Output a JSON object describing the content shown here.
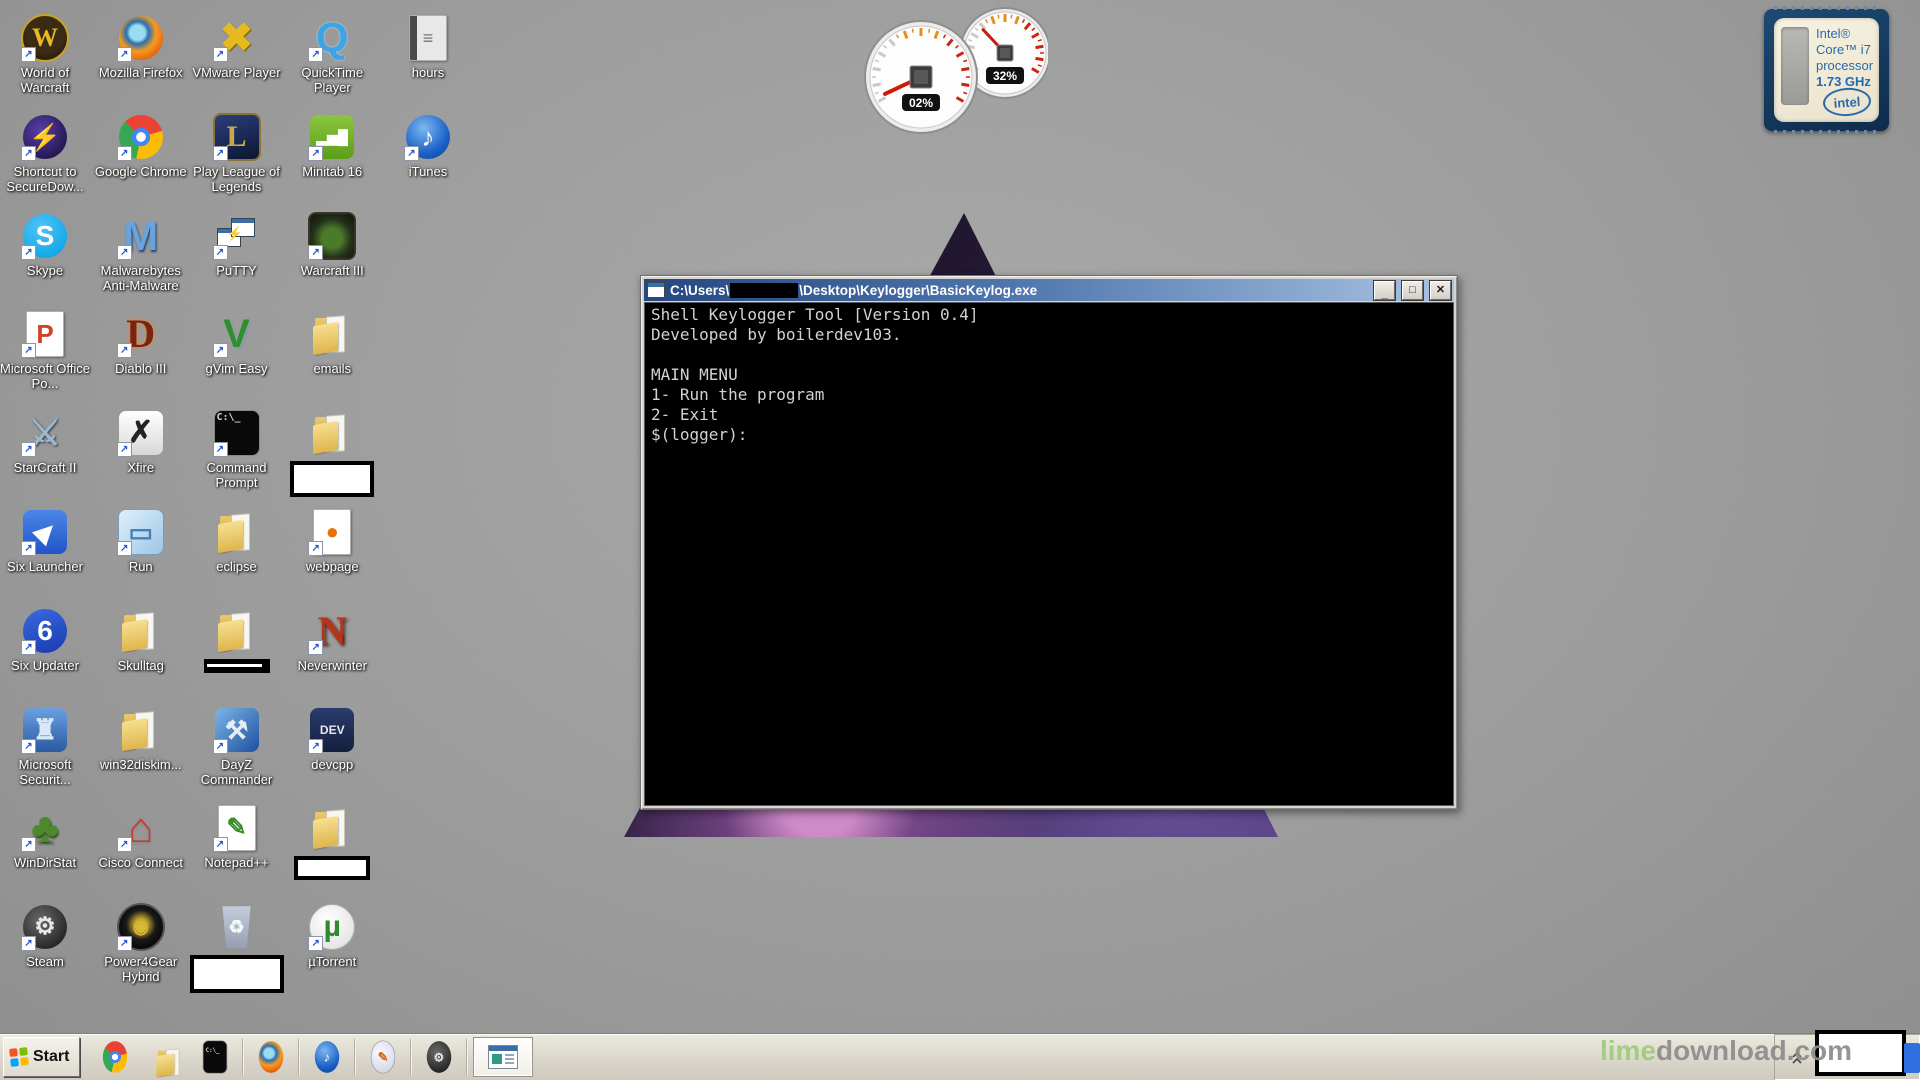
{
  "desktop": {
    "background_color": "#9b9b9b",
    "wallpaper_logo": "purple-galaxy-triangle",
    "icons": [
      {
        "id": "world-of-warcraft",
        "label": "World of Warcraft",
        "col": 1,
        "row": 1,
        "shortcut": true,
        "art": {
          "shape": "circle",
          "bg": "radial-gradient(circle at 50% 40%, #3a2c14 0 55%, #120d04 100%)",
          "border": "2px solid #c9a227",
          "glyph": "W",
          "gcolor": "#e8b923",
          "gsize": 26,
          "serif": true
        }
      },
      {
        "id": "mozilla-firefox",
        "label": "Mozilla Firefox",
        "col": 2,
        "row": 1,
        "shortcut": true,
        "art": {
          "shape": "circle",
          "bg": "radial-gradient(circle at 42% 38%, #9adcf0 0 20%, #2a6fb0 30%, #f79b1e 50%, #e4650e 75%, #b23d05 100%)"
        }
      },
      {
        "id": "vmware-player",
        "label": "VMware Player",
        "col": 3,
        "row": 1,
        "shortcut": true,
        "art": {
          "shape": "none",
          "glyph": "✖",
          "gcolor": "#e6b91e",
          "gsize": 40,
          "gshadow": "1px 1px 1px #7a5c00"
        }
      },
      {
        "id": "quicktime-player",
        "label": "QuickTime Player",
        "col": 4,
        "row": 1,
        "shortcut": true,
        "art": {
          "shape": "none",
          "glyph": "Q",
          "gcolor": "#3fa3e8",
          "gsize": 42,
          "gshadow": "0 0 2px #b8e0f8"
        }
      },
      {
        "id": "hours",
        "label": "hours",
        "col": 5,
        "row": 1,
        "shortcut": false,
        "art": {
          "shape": "doc",
          "bg": "linear-gradient(90deg,#4a4a4a 0 20%, #e8e8e8 20% 100%)",
          "glyph": "≡",
          "gcolor": "#777",
          "gsize": 18
        }
      },
      {
        "id": "shortcut-to-securedow",
        "label": "Shortcut to SecureDow...",
        "col": 1,
        "row": 2,
        "shortcut": true,
        "art": {
          "shape": "circle",
          "bg": "radial-gradient(circle at 40% 35%, #5a3fa8, #261a58 70%)",
          "glyph": "⚡",
          "gcolor": "#f5c518",
          "gsize": 26
        }
      },
      {
        "id": "google-chrome",
        "label": "Google Chrome",
        "col": 2,
        "row": 2,
        "shortcut": true,
        "art": {
          "shape": "circle",
          "bg": "radial-gradient(circle at 50% 50%, #ffffff 0 15%, #4285f4 16% 29%, rgba(0,0,0,0) 30%), conic-gradient(from -45deg, #ea4335 0 33%, #fbbc05 0 66%, #34a853 0 100%)"
        }
      },
      {
        "id": "play-league-of-legends",
        "label": "Play League of Legends",
        "col": 3,
        "row": 2,
        "shortcut": true,
        "art": {
          "shape": "rsq",
          "bg": "linear-gradient(160deg,#2a3f7e,#0c1630)",
          "border": "2px solid #8a7438",
          "glyph": "L",
          "gcolor": "#c8a84a",
          "gsize": 30,
          "serif": true
        }
      },
      {
        "id": "minitab-16",
        "label": "Minitab 16",
        "col": 4,
        "row": 2,
        "shortcut": true,
        "art": {
          "shape": "rsq",
          "bg": "linear-gradient(180deg,#8cc63f,#5a9e1a)",
          "glyph": "▂▅█",
          "gcolor": "#ffffff",
          "gsize": 14
        }
      },
      {
        "id": "itunes",
        "label": "iTunes",
        "col": 5,
        "row": 2,
        "shortcut": true,
        "art": {
          "shape": "circle",
          "bg": "radial-gradient(circle at 40% 30%, #7db8f0, #1c63c8 60%, #0b3f96)",
          "glyph": "♪",
          "gcolor": "#ffffff",
          "gsize": 26
        }
      },
      {
        "id": "skype",
        "label": "Skype",
        "col": 1,
        "row": 3,
        "shortcut": true,
        "art": {
          "shape": "circle",
          "bg": "radial-gradient(circle at 40% 30%, #4fc3f7, #009fe3)",
          "glyph": "S",
          "gcolor": "#ffffff",
          "gsize": 28
        }
      },
      {
        "id": "malwarebytes-anti-malware",
        "label": "Malwarebytes Anti-Malware",
        "col": 2,
        "row": 3,
        "shortcut": true,
        "art": {
          "shape": "none",
          "glyph": "M",
          "gcolor": "#6aa2dc",
          "gsize": 42,
          "gshadow": "1px 2px 2px #1c3c64"
        }
      },
      {
        "id": "putty",
        "label": "PuTTY",
        "col": 3,
        "row": 3,
        "shortcut": true,
        "art": {
          "shape": "putty"
        }
      },
      {
        "id": "warcraft-iii",
        "label": "Warcraft III",
        "col": 4,
        "row": 3,
        "shortcut": true,
        "art": {
          "shape": "rsq",
          "bg": "radial-gradient(circle at 50% 55%, #4a7a2a 0 30%, #22301a 60%, #121208 100%)",
          "border": "2px solid #3a3424"
        }
      },
      {
        "id": "microsoft-office-po",
        "label": "Microsoft Office Po...",
        "col": 1,
        "row": 4,
        "shortcut": true,
        "art": {
          "shape": "doc",
          "bg": "#ffffff",
          "glyph": "P",
          "gcolor": "#d04423",
          "gsize": 26
        }
      },
      {
        "id": "diablo-iii",
        "label": "Diablo III",
        "col": 2,
        "row": 4,
        "shortcut": true,
        "art": {
          "shape": "none",
          "glyph": "D",
          "gcolor": "#7a2410",
          "gsize": 40,
          "serif": true,
          "gshadow": "0 0 4px #f08030"
        }
      },
      {
        "id": "gvim-easy",
        "label": "gVim Easy",
        "col": 3,
        "row": 4,
        "shortcut": true,
        "art": {
          "shape": "none",
          "glyph": "V",
          "gcolor": "#2f8f2f",
          "gsize": 40,
          "gshadow": "2px 2px 2px #8a9aa8"
        }
      },
      {
        "id": "emails",
        "label": "emails",
        "col": 4,
        "row": 4,
        "shortcut": false,
        "art": {
          "shape": "folder"
        }
      },
      {
        "id": "starcraft-ii",
        "label": "StarCraft II",
        "col": 1,
        "row": 5,
        "shortcut": true,
        "art": {
          "shape": "none",
          "glyph": "⚔",
          "gcolor": "#9fb6c8",
          "gsize": 36,
          "gshadow": "1px 1px 2px #2a3a4a"
        }
      },
      {
        "id": "xfire",
        "label": "Xfire",
        "col": 2,
        "row": 5,
        "shortcut": true,
        "art": {
          "shape": "rsq",
          "bg": "linear-gradient(180deg,#ffffff,#d8d8d8)",
          "border": "1px solid #999",
          "glyph": "✗",
          "gcolor": "#222",
          "gsize": 30
        }
      },
      {
        "id": "command-prompt",
        "label": "Command Prompt",
        "col": 3,
        "row": 5,
        "shortcut": true,
        "art": {
          "shape": "rsq",
          "bg": "#0a0a0a",
          "border": "1px solid #888",
          "glyph": "C:\\_",
          "gcolor": "#d8d8d8",
          "gsize": 10,
          "tl": true
        }
      },
      {
        "id": "censored-folder-1",
        "label": "",
        "col": 4,
        "row": 5,
        "shortcut": false,
        "censor": "white-box",
        "cw": 76,
        "ch": 28,
        "art": {
          "shape": "folder"
        }
      },
      {
        "id": "six-launcher",
        "label": "Six Launcher",
        "col": 1,
        "row": 6,
        "shortcut": true,
        "art": {
          "shape": "rsq",
          "bg": "linear-gradient(180deg,#4a86e8,#2255c8)",
          "glyph": "▶",
          "gcolor": "#ffffff",
          "gsize": 24,
          "rot": true
        }
      },
      {
        "id": "run",
        "label": "Run",
        "col": 2,
        "row": 6,
        "shortcut": true,
        "art": {
          "shape": "rsq",
          "bg": "linear-gradient(135deg,#dff0fa,#9cc6e8)",
          "border": "1px solid #7a9ab8",
          "glyph": "▭",
          "gcolor": "#4a80b8",
          "gsize": 26
        }
      },
      {
        "id": "eclipse",
        "label": "eclipse",
        "col": 3,
        "row": 6,
        "shortcut": false,
        "art": {
          "shape": "folder"
        }
      },
      {
        "id": "webpage",
        "label": "webpage",
        "col": 4,
        "row": 6,
        "shortcut": true,
        "art": {
          "shape": "doc",
          "bg": "#ffffff",
          "glyph": "●",
          "gcolor": "#e8710a",
          "gsize": 22
        }
      },
      {
        "id": "six-updater",
        "label": "Six Updater",
        "col": 1,
        "row": 7,
        "shortcut": true,
        "art": {
          "shape": "circle",
          "bg": "linear-gradient(160deg,#3a6ae0,#1a3ab0)",
          "glyph": "6",
          "gcolor": "#ffffff",
          "gsize": 28
        }
      },
      {
        "id": "skulltag",
        "label": "Skulltag",
        "col": 2,
        "row": 7,
        "shortcut": false,
        "art": {
          "shape": "folder"
        }
      },
      {
        "id": "censored-folder-2",
        "label": "",
        "col": 3,
        "row": 7,
        "shortcut": false,
        "censor": "black-bar",
        "cw": 66,
        "ch": 14,
        "art": {
          "shape": "folder"
        }
      },
      {
        "id": "neverwinter",
        "label": "Neverwinter",
        "col": 4,
        "row": 7,
        "shortcut": true,
        "art": {
          "shape": "none",
          "glyph": "N",
          "gcolor": "#b83418",
          "gsize": 40,
          "serif": true,
          "gshadow": "2px 2px 3px #3a0e04"
        }
      },
      {
        "id": "microsoft-securit",
        "label": "Microsoft Securit...",
        "col": 1,
        "row": 8,
        "shortcut": true,
        "art": {
          "shape": "rsq",
          "bg": "linear-gradient(180deg,#6aa0e0,#2a5aa0)",
          "glyph": "♜",
          "gcolor": "#d8e8f8",
          "gsize": 28
        }
      },
      {
        "id": "win32diskim",
        "label": "win32diskim...",
        "col": 2,
        "row": 8,
        "shortcut": false,
        "art": {
          "shape": "folder"
        }
      },
      {
        "id": "dayz-commander",
        "label": "DayZ Commander",
        "col": 3,
        "row": 8,
        "shortcut": true,
        "art": {
          "shape": "rsq",
          "bg": "linear-gradient(135deg,#7ab6e8,#1e4f9e)",
          "glyph": "⚒",
          "gcolor": "#e8edf4",
          "gsize": 26
        }
      },
      {
        "id": "devcpp",
        "label": "devcpp",
        "col": 4,
        "row": 8,
        "shortcut": true,
        "art": {
          "shape": "rsq",
          "bg": "linear-gradient(180deg,#2a3c6e,#14203e)",
          "glyph": "DEV",
          "gcolor": "#e8e8f0",
          "gsize": 12
        }
      },
      {
        "id": "windirstat",
        "label": "WinDirStat",
        "col": 1,
        "row": 9,
        "shortcut": true,
        "art": {
          "shape": "none",
          "glyph": "♣",
          "gcolor": "#4a8a2a",
          "gsize": 42,
          "gshadow": "1px 2px 2px #2a4a1a"
        }
      },
      {
        "id": "cisco-connect",
        "label": "Cisco Connect",
        "col": 2,
        "row": 9,
        "shortcut": true,
        "art": {
          "shape": "none",
          "glyph": "⌂",
          "gcolor": "#c23a2e",
          "gsize": 42,
          "gshadow": "0 2px 2px #888"
        }
      },
      {
        "id": "notepadpp",
        "label": "Notepad++",
        "col": 3,
        "row": 9,
        "shortcut": true,
        "art": {
          "shape": "doc",
          "bg": "#ffffff",
          "glyph": "✎",
          "gcolor": "#3a8a2a",
          "gsize": 24
        }
      },
      {
        "id": "censored-folder-3",
        "label": "",
        "col": 4,
        "row": 9,
        "shortcut": false,
        "censor": "white-box",
        "cw": 68,
        "ch": 16,
        "art": {
          "shape": "folder"
        }
      },
      {
        "id": "steam",
        "label": "Steam",
        "col": 1,
        "row": 10,
        "shortcut": true,
        "art": {
          "shape": "circle",
          "bg": "radial-gradient(circle at 40% 35%, #6a6a6a, #2a2a2a 70%, #111 100%)",
          "glyph": "⚙",
          "gcolor": "#e8e8e8",
          "gsize": 24
        }
      },
      {
        "id": "power4gear-hybrid",
        "label": "Power4Gear Hybrid",
        "col": 2,
        "row": 10,
        "shortcut": true,
        "art": {
          "shape": "circle",
          "bg": "radial-gradient(circle at 50% 45%, #c8a830 0 18%, #1a1a1a 45%, #000 85%)",
          "border": "2px solid #555",
          "glyph": "◉",
          "gcolor": "#d8b838",
          "gsize": 18
        }
      },
      {
        "id": "recycle-bin",
        "label": "",
        "col": 3,
        "row": 10,
        "shortcut": false,
        "censor": "white-box",
        "cw": 86,
        "ch": 30,
        "art": {
          "shape": "bin",
          "glyph": "♻",
          "gcolor": "rgba(255,255,255,0.9)",
          "gsize": 18
        }
      },
      {
        "id": "utorrent",
        "label": "µTorrent",
        "col": 4,
        "row": 10,
        "shortcut": true,
        "art": {
          "shape": "circle",
          "bg": "radial-gradient(circle at 40% 35%, #ffffff, #dcdcdc)",
          "border": "1px solid #aaa",
          "glyph": "µ",
          "gcolor": "#2e8b2e",
          "gsize": 30
        }
      }
    ]
  },
  "gadgets": {
    "cpu_meter": {
      "cpu_percent": 2,
      "cpu_label": "02%",
      "ram_percent": 32,
      "ram_label": "32%"
    },
    "intel": {
      "lines": [
        "Intel®",
        "Core™ i7",
        "processor",
        "1.73 GHz"
      ],
      "logo_text": "intel"
    }
  },
  "terminal": {
    "title_prefix": "C:\\Users\\",
    "title_censored": true,
    "title_suffix": "\\Desktop\\Keylogger\\BasicKeylog.exe",
    "buttons": {
      "minimize": "_",
      "maximize": "□",
      "close": "✕"
    },
    "lines": [
      "Shell Keylogger Tool [Version 0.4]",
      "Developed by boilerdev103.",
      "",
      "MAIN MENU",
      "1- Run the program",
      "2- Exit",
      "$(logger):"
    ]
  },
  "taskbar": {
    "start_label": "Start",
    "flag_colors": [
      "#f35325",
      "#81bc06",
      "#05a6f0",
      "#ffba08"
    ],
    "quick_launch": [
      {
        "id": "chrome",
        "art": {
          "shape": "circle",
          "bg": "radial-gradient(circle at 50% 50%, #ffffff 0 15%, #4285f4 16% 29%, rgba(0,0,0,0) 30%), conic-gradient(from -45deg, #ea4335 0 33%, #fbbc05 0 66%, #34a853 0 100%)"
        }
      },
      {
        "id": "windows-explorer",
        "art": {
          "shape": "folder"
        }
      },
      {
        "id": "command-prompt",
        "art": {
          "shape": "rsq",
          "bg": "#0a0a0a",
          "border": "1px solid #888",
          "glyph": "C:\\_",
          "gcolor": "#d8d8d8",
          "gsize": 8,
          "tl": true
        }
      },
      {
        "id": "firefox",
        "sep": true,
        "art": {
          "shape": "circle",
          "bg": "radial-gradient(circle at 42% 38%, #9adcf0 0 20%, #2a6fb0 30%, #f79b1e 50%, #e4650e 75%, #b23d05 100%)"
        }
      },
      {
        "id": "itunes",
        "sep": true,
        "art": {
          "shape": "circle",
          "bg": "radial-gradient(circle at 40% 30%, #7db8f0, #1c63c8 60%, #0b3f96)",
          "glyph": "♪",
          "gcolor": "#ffffff",
          "gsize": 18
        }
      },
      {
        "id": "paint",
        "sep": true,
        "art": {
          "shape": "circle",
          "bg": "radial-gradient(circle at 35% 35%, #f8f8ff, #cfd0e0)",
          "border": "1px solid #9a9ab0",
          "glyph": "✎",
          "gcolor": "#d86a1a",
          "gsize": 18
        }
      },
      {
        "id": "steam",
        "sep": true,
        "art": {
          "shape": "circle",
          "bg": "radial-gradient(circle at 40% 35%, #6a6a6a, #2a2a2a 70%, #111 100%)",
          "glyph": "⚙",
          "gcolor": "#e8e8e8",
          "gsize": 17
        }
      }
    ],
    "active_window": {
      "id": "basickeylog-window"
    },
    "tray_icons": [
      "expand",
      "network",
      "action-center-flag",
      "power",
      "volume"
    ],
    "clock_censored": true
  },
  "watermark": {
    "green": "lime",
    "gray": "download.com",
    "green_color": "#9fcb7c",
    "gray_color": "#8c8c8c"
  }
}
